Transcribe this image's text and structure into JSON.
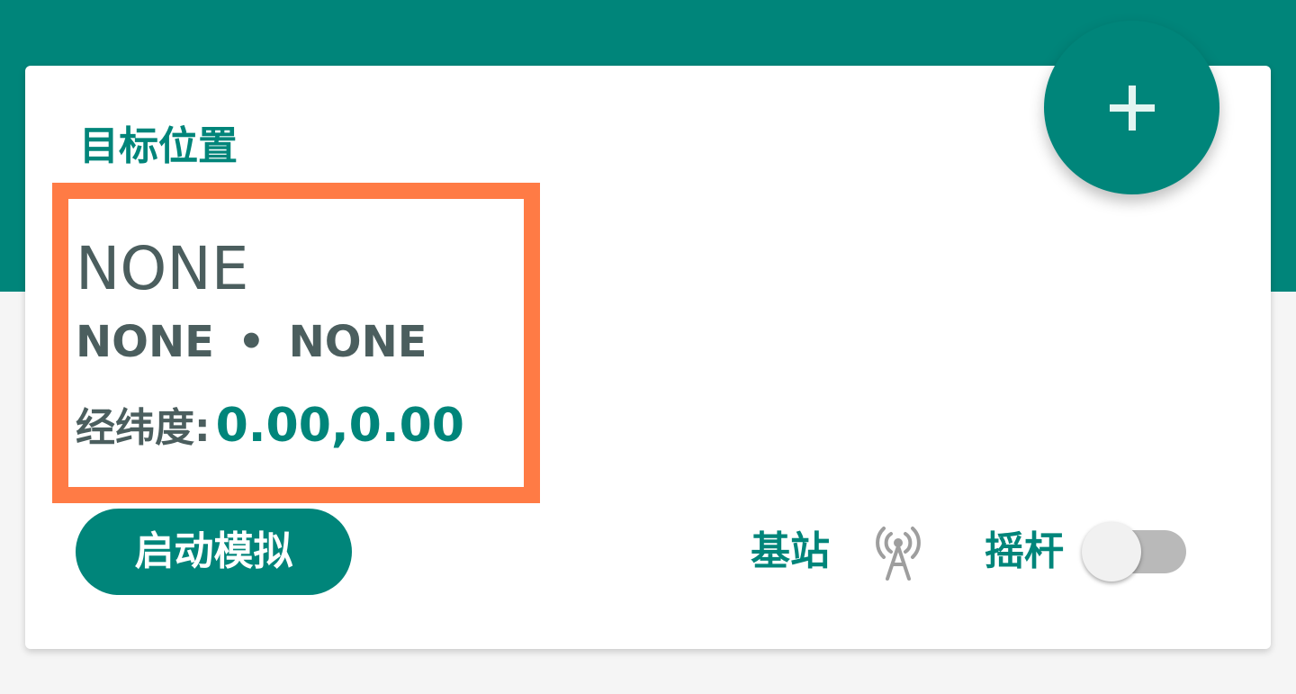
{
  "colors": {
    "accent": "#00857a",
    "highlight": "#ff7b45",
    "text_dark": "#4b5e5e",
    "background": "#f5f5f5",
    "card": "#ffffff",
    "toggle_off_track": "#b9b9b9"
  },
  "card": {
    "title": "目标位置",
    "place_name": "NONE",
    "place_sub_left": "NONE",
    "place_sub_separator": "•",
    "place_sub_right": "NONE",
    "coords_label": "经纬度:",
    "coords_value": "0.00,0.00",
    "start_button_label": "启动模拟",
    "station_label": "基站",
    "station_icon": "antenna-icon",
    "joystick_label": "摇杆",
    "joystick_toggle_on": false
  },
  "fab": {
    "icon": "plus-icon"
  }
}
